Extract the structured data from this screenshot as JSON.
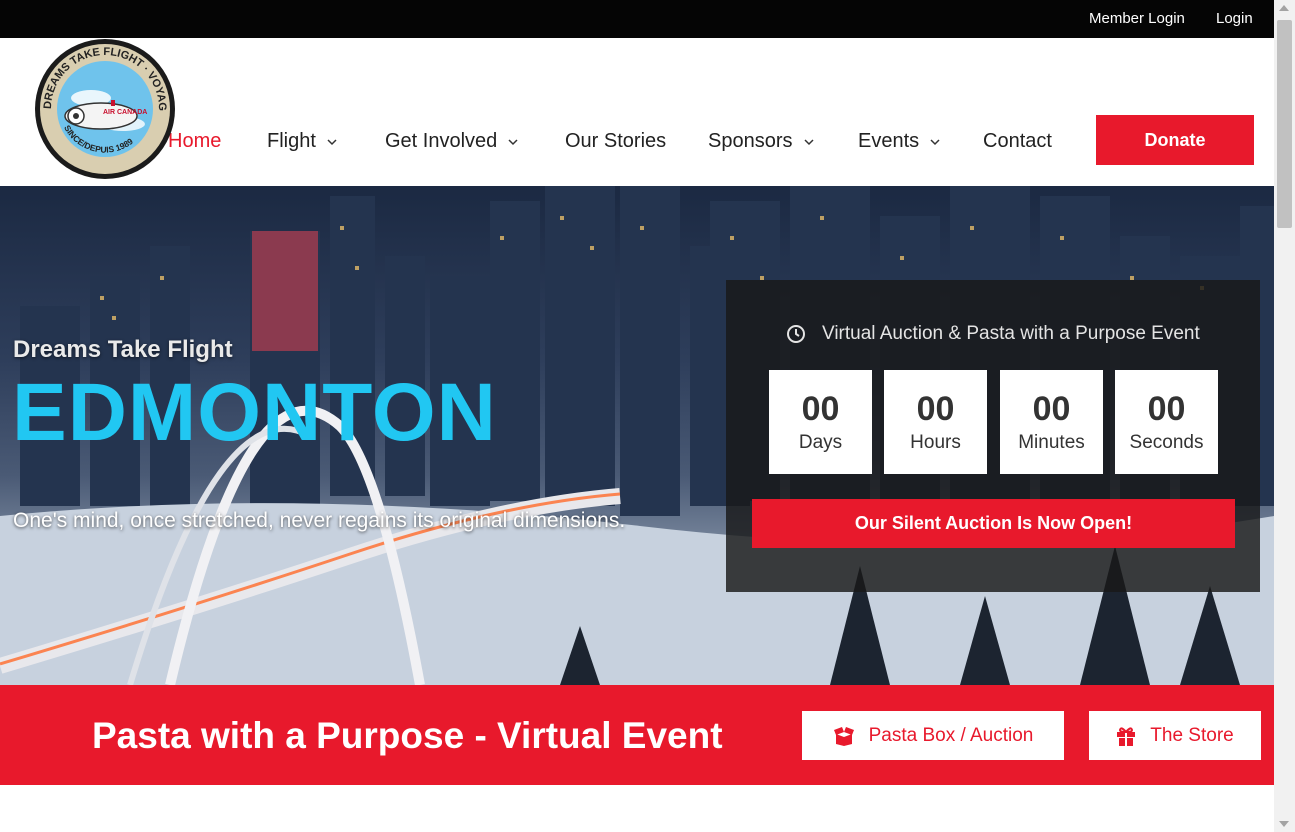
{
  "topbar": {
    "member_login": "Member Login",
    "login": "Login"
  },
  "logo": {
    "ring_text": "DREAMS TAKE FLIGHT · VOYAGE DE RÊVE ·",
    "since_text": "SINCE/DEPUIS 1989",
    "plane_text": "AIR CANADA"
  },
  "nav": {
    "items": [
      {
        "label": "Home",
        "active": true,
        "dropdown": false
      },
      {
        "label": "Flight",
        "active": false,
        "dropdown": true
      },
      {
        "label": "Get Involved",
        "active": false,
        "dropdown": true
      },
      {
        "label": "Our Stories",
        "active": false,
        "dropdown": false
      },
      {
        "label": "Sponsors",
        "active": false,
        "dropdown": true
      },
      {
        "label": "Events",
        "active": false,
        "dropdown": true
      },
      {
        "label": "Contact",
        "active": false,
        "dropdown": false
      }
    ],
    "donate_label": "Donate"
  },
  "hero": {
    "subtitle": "Dreams Take Flight",
    "title": "EDMONTON",
    "quote": "One's mind, once stretched, never regains its original dimensions."
  },
  "countdown": {
    "event_title": "Virtual  Auction & Pasta with a Purpose Event",
    "units": [
      {
        "value": "00",
        "label": "Days"
      },
      {
        "value": "00",
        "label": "Hours"
      },
      {
        "value": "00",
        "label": "Minutes"
      },
      {
        "value": "00",
        "label": "Seconds"
      }
    ],
    "button_label": "Our Silent Auction Is Now Open!"
  },
  "band": {
    "title": "Pasta with a Purpose - Virtual Event",
    "buttons": [
      {
        "label": "Pasta Box / Auction",
        "icon": "box-open-icon"
      },
      {
        "label": "The Store",
        "icon": "gift-icon"
      }
    ]
  },
  "colors": {
    "accent_red": "#e8192c",
    "hero_title_blue": "#21c7f2",
    "topbar_black": "#050505"
  }
}
